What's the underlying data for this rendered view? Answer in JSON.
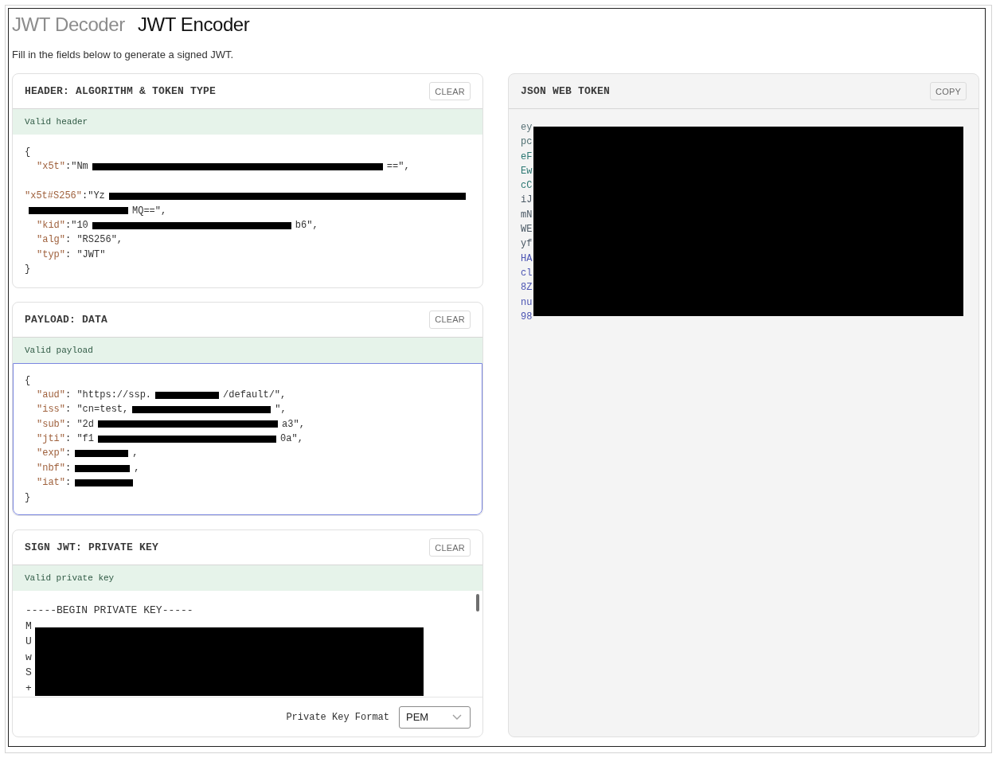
{
  "tabs": [
    {
      "label": "JWT Decoder",
      "selected": false
    },
    {
      "label": "JWT Encoder",
      "selected": true
    }
  ],
  "intro": "Fill in the fields below to generate a signed JWT.",
  "input_panels": [
    {
      "kind": "json",
      "title": "HEADER: ALGORITHM & TOKEN TYPE",
      "clear_button": "CLEAR",
      "status": {
        "text": "Valid header",
        "valid": true
      },
      "editor": {
        "focused": false,
        "lines": [
          {
            "kind": "code",
            "indented": false,
            "segments": [
              {
                "kind": "text",
                "text": "{"
              }
            ]
          },
          {
            "kind": "code",
            "indented": true,
            "segments": [
              {
                "kind": "key",
                "text": "\"x5t\""
              },
              {
                "kind": "text",
                "text": ":\"Nm"
              },
              {
                "kind": "redacted"
              },
              {
                "kind": "text",
                "text": "==\","
              }
            ]
          },
          {
            "kind": "blank"
          },
          {
            "kind": "code",
            "indented": false,
            "segments": [
              {
                "kind": "key",
                "text": "\"x5t#S256\""
              },
              {
                "kind": "text",
                "text": ":\"Yz"
              },
              {
                "kind": "redacted"
              }
            ]
          },
          {
            "kind": "code",
            "indented": false,
            "segments": [
              {
                "kind": "redacted"
              },
              {
                "kind": "text",
                "text": "MQ==\","
              }
            ]
          },
          {
            "kind": "code",
            "indented": true,
            "segments": [
              {
                "kind": "key",
                "text": "\"kid\""
              },
              {
                "kind": "text",
                "text": ":\"10"
              },
              {
                "kind": "redacted"
              },
              {
                "kind": "text",
                "text": "b6\","
              }
            ]
          },
          {
            "kind": "code",
            "indented": true,
            "segments": [
              {
                "kind": "key",
                "text": "\"alg\""
              },
              {
                "kind": "text",
                "text": ": \"RS256\","
              }
            ]
          },
          {
            "kind": "code",
            "indented": true,
            "segments": [
              {
                "kind": "key",
                "text": "\"typ\""
              },
              {
                "kind": "text",
                "text": ": \"JWT\""
              }
            ]
          },
          {
            "kind": "code",
            "indented": false,
            "segments": [
              {
                "kind": "text",
                "text": "}"
              }
            ]
          }
        ]
      }
    },
    {
      "kind": "json",
      "title": "PAYLOAD: DATA",
      "clear_button": "CLEAR",
      "status": {
        "text": "Valid payload",
        "valid": true
      },
      "editor": {
        "focused": true,
        "lines": [
          {
            "kind": "code",
            "indented": false,
            "segments": [
              {
                "kind": "text",
                "text": "{"
              }
            ]
          },
          {
            "kind": "code",
            "indented": true,
            "segments": [
              {
                "kind": "key",
                "text": "\"aud\""
              },
              {
                "kind": "text",
                "text": ": \"https://ssp."
              },
              {
                "kind": "redacted"
              },
              {
                "kind": "text",
                "text": "/default/\","
              }
            ]
          },
          {
            "kind": "code",
            "indented": true,
            "segments": [
              {
                "kind": "key",
                "text": "\"iss\""
              },
              {
                "kind": "text",
                "text": ": \"cn=test,"
              },
              {
                "kind": "redacted"
              },
              {
                "kind": "text",
                "text": "\","
              }
            ]
          },
          {
            "kind": "code",
            "indented": true,
            "segments": [
              {
                "kind": "key",
                "text": "\"sub\""
              },
              {
                "kind": "text",
                "text": ": \"2d"
              },
              {
                "kind": "redacted"
              },
              {
                "kind": "text",
                "text": "a3\","
              }
            ]
          },
          {
            "kind": "code",
            "indented": true,
            "segments": [
              {
                "kind": "key",
                "text": "\"jti\""
              },
              {
                "kind": "text",
                "text": ": \"f1"
              },
              {
                "kind": "redacted"
              },
              {
                "kind": "text",
                "text": "0a\","
              }
            ]
          },
          {
            "kind": "code",
            "indented": true,
            "segments": [
              {
                "kind": "key",
                "text": "\"exp\""
              },
              {
                "kind": "text",
                "text": ":"
              },
              {
                "kind": "redacted"
              },
              {
                "kind": "text",
                "text": ","
              }
            ]
          },
          {
            "kind": "code",
            "indented": true,
            "segments": [
              {
                "kind": "key",
                "text": "\"nbf\""
              },
              {
                "kind": "text",
                "text": ":"
              },
              {
                "kind": "redacted"
              },
              {
                "kind": "text",
                "text": ","
              }
            ]
          },
          {
            "kind": "code",
            "indented": true,
            "segments": [
              {
                "kind": "key",
                "text": "\"iat\""
              },
              {
                "kind": "text",
                "text": ":"
              },
              {
                "kind": "redacted"
              }
            ]
          },
          {
            "kind": "code",
            "indented": false,
            "segments": [
              {
                "kind": "text",
                "text": "}"
              }
            ]
          }
        ]
      }
    },
    {
      "kind": "key",
      "title": "SIGN JWT: PRIVATE KEY",
      "clear_button": "CLEAR",
      "status": {
        "text": "Valid private key",
        "valid": true
      },
      "editor": {
        "focused": false,
        "redacted": true,
        "lines": [
          "-----BEGIN PRIVATE KEY-----",
          "M",
          "U",
          "w",
          "S",
          "+"
        ]
      },
      "key_format": {
        "label": "Private Key Format",
        "value": "PEM"
      }
    }
  ],
  "output_panel": {
    "title": "JSON WEB TOKEN",
    "copy_button": "COPY",
    "redacted": true,
    "lines": [
      {
        "text": "ey",
        "color": "#5c7479"
      },
      {
        "text": "pc",
        "color": "#4d6e70"
      },
      {
        "text": "eF",
        "color": "#2b7772"
      },
      {
        "text": "Ew",
        "color": "#2b7772"
      },
      {
        "text": "cC",
        "color": "#2b7772"
      },
      {
        "text": "iJ",
        "color": "#4a5864"
      },
      {
        "text": "mN",
        "color": "#4a5864"
      },
      {
        "text": "WE",
        "color": "#4a5864"
      },
      {
        "text": "yf",
        "color": "#4a5864"
      },
      {
        "text": "HA",
        "color": "#4c55b3"
      },
      {
        "text": "cl",
        "color": "#4c55b3"
      },
      {
        "text": "8Z",
        "color": "#4c55b3"
      },
      {
        "text": "nu",
        "color": "#4c55b3"
      },
      {
        "text": "98",
        "color": "#4c55b3"
      }
    ]
  }
}
